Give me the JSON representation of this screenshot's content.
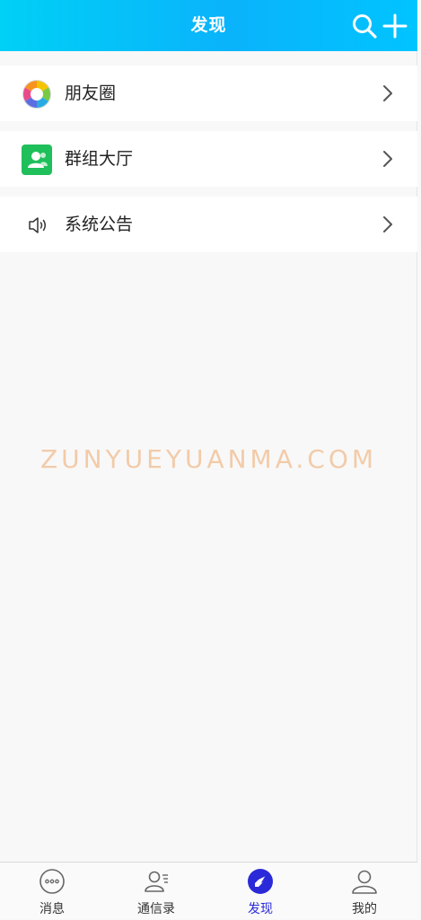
{
  "header": {
    "title": "发现",
    "search_icon": "search-icon",
    "add_icon": "plus-icon"
  },
  "list": [
    {
      "label": "朋友圈",
      "icon": "aperture-icon"
    },
    {
      "label": "群组大厅",
      "icon": "group-contacts-icon"
    },
    {
      "label": "系统公告",
      "icon": "speaker-icon"
    }
  ],
  "watermark": "ZUNYUEYUANMA.COM",
  "tabbar": {
    "items": [
      {
        "label": "消息",
        "icon": "chat-bubble-icon",
        "active": false
      },
      {
        "label": "通信录",
        "icon": "contacts-icon",
        "active": false
      },
      {
        "label": "发现",
        "icon": "compass-icon",
        "active": true
      },
      {
        "label": "我的",
        "icon": "user-icon",
        "active": false
      }
    ]
  },
  "colors": {
    "header_start": "#00d0f6",
    "header_end": "#0ab3fb",
    "active_tab": "#2a2ad8",
    "group_icon_bg": "#1fbf5b",
    "watermark": "#f2c7a1"
  }
}
